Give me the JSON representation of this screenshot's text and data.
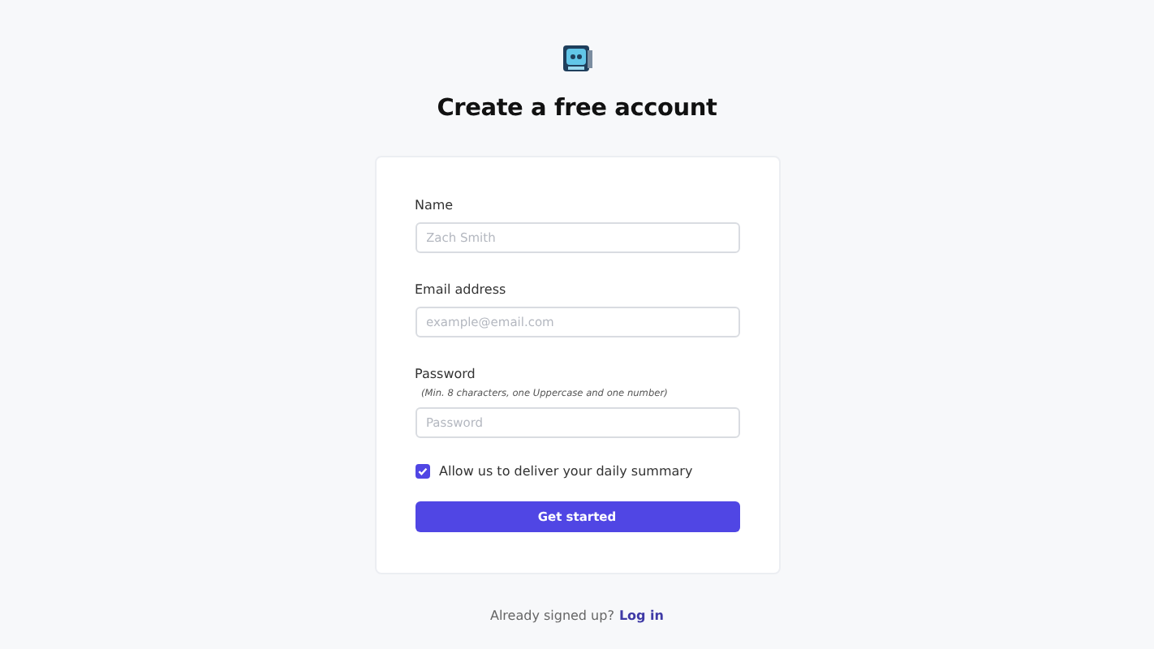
{
  "title": "Create a free account",
  "fields": [
    {
      "label": "Name",
      "placeholder": "Zach Smith"
    },
    {
      "label": "Email address",
      "placeholder": "example@email.com"
    },
    {
      "label": "Password",
      "hint": "(Min. 8 characters, one Uppercase and one number)",
      "placeholder": "Password"
    }
  ],
  "consent": {
    "label": "Allow us to deliver your daily summary",
    "checked": true
  },
  "submit": "Get started",
  "footer": {
    "text": "Already signed up?",
    "link": "Log in"
  }
}
